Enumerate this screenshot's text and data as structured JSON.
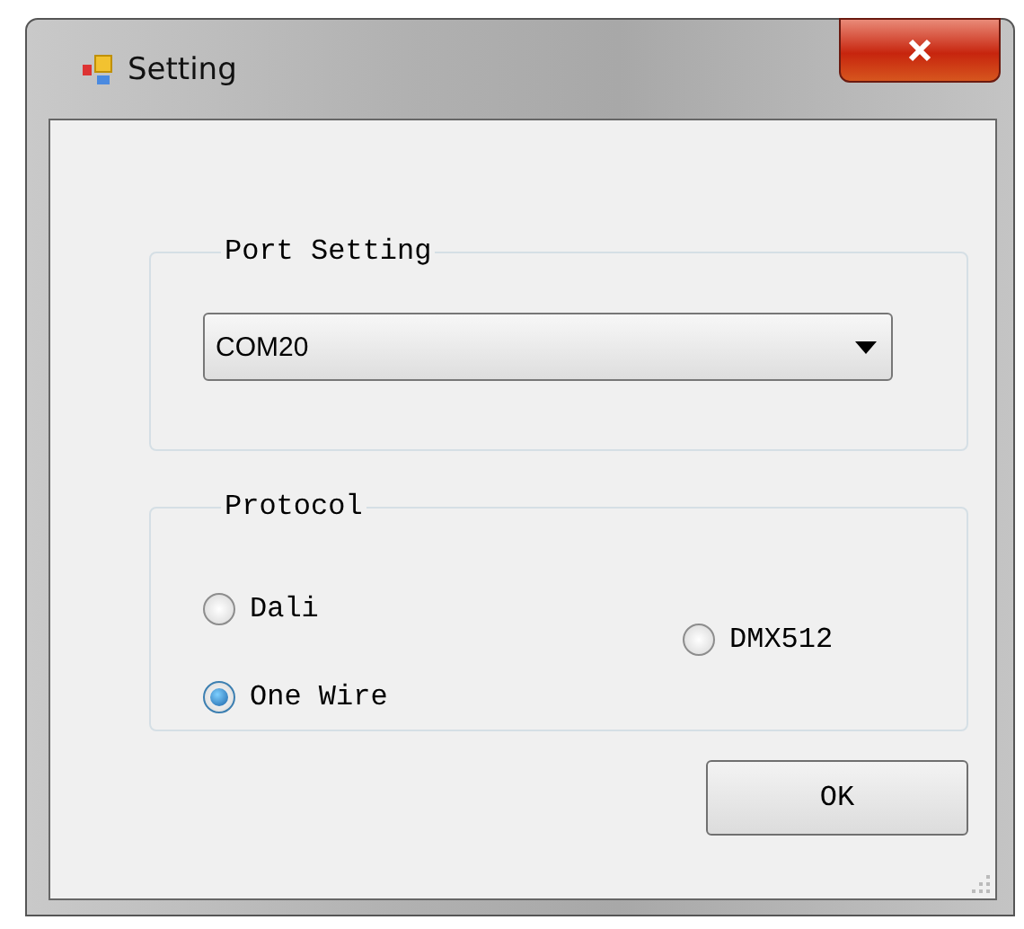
{
  "window": {
    "title": "Setting"
  },
  "port_setting": {
    "label": "Port Setting",
    "value": "COM20"
  },
  "protocol": {
    "label": "Protocol",
    "options": [
      {
        "label": "Dali",
        "selected": false
      },
      {
        "label": "One Wire",
        "selected": true
      },
      {
        "label": "DMX512",
        "selected": false
      }
    ]
  },
  "buttons": [
    "OK"
  ]
}
